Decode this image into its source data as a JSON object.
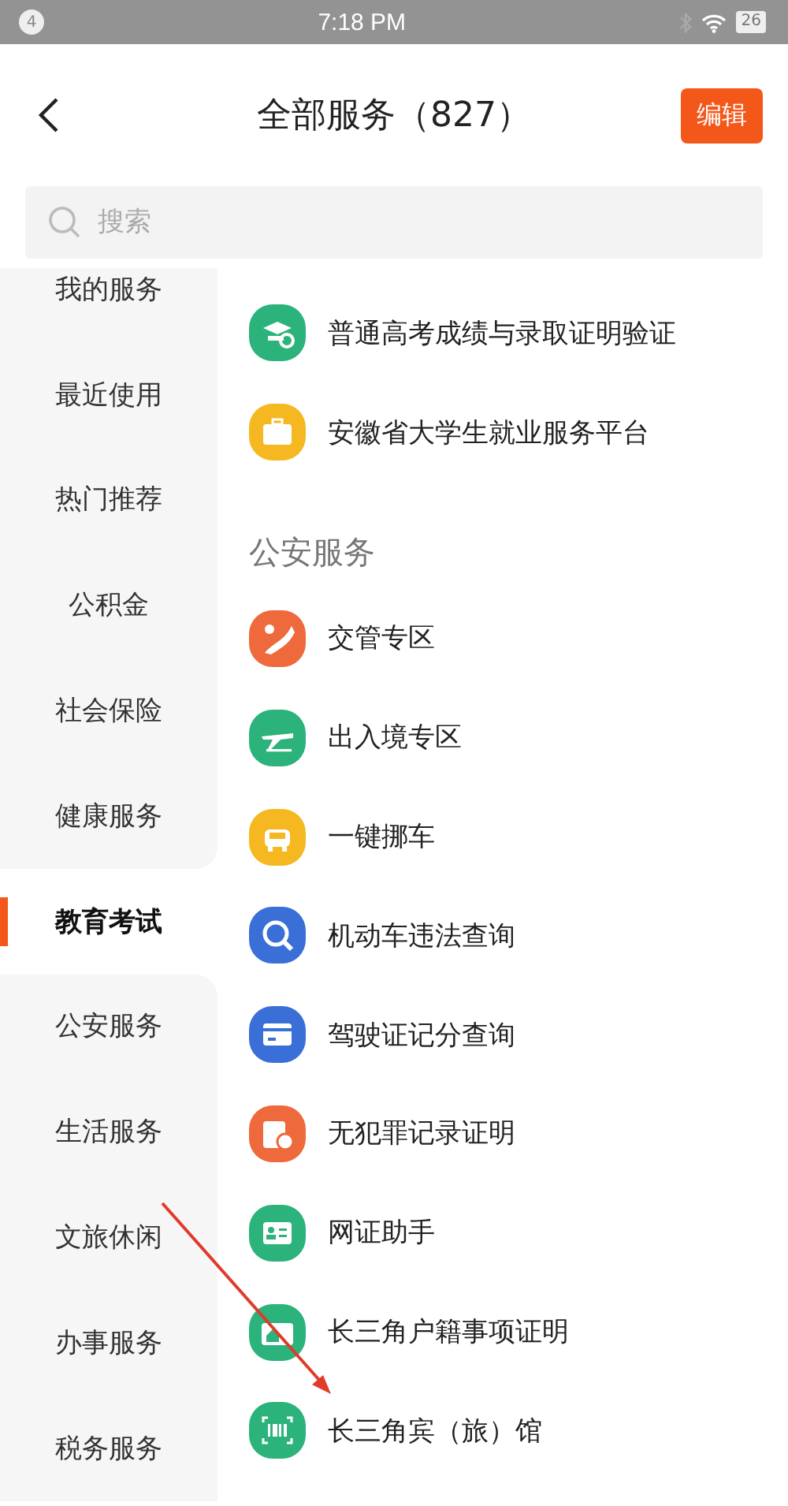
{
  "status_bar": {
    "notification_count": "4",
    "time": "7:18 PM",
    "battery": "26"
  },
  "header": {
    "title": "全部服务（827）",
    "edit_button": "编辑"
  },
  "search": {
    "placeholder": "搜索"
  },
  "sidebar": {
    "items": [
      {
        "label": "我的服务",
        "selected": false
      },
      {
        "label": "最近使用",
        "selected": false
      },
      {
        "label": "热门推荐",
        "selected": false
      },
      {
        "label": "公积金",
        "selected": false
      },
      {
        "label": "社会保险",
        "selected": false
      },
      {
        "label": "健康服务",
        "selected": false
      },
      {
        "label": "教育考试",
        "selected": true
      },
      {
        "label": "公安服务",
        "selected": false
      },
      {
        "label": "生活服务",
        "selected": false
      },
      {
        "label": "文旅休闲",
        "selected": false
      },
      {
        "label": "办事服务",
        "selected": false
      },
      {
        "label": "税务服务",
        "selected": false
      }
    ]
  },
  "sections": [
    {
      "services": [
        {
          "label": "普通高考成绩与录取证明验证",
          "color": "#2bb37b"
        },
        {
          "label": "安徽省大学生就业服务平台",
          "color": "#f5b820"
        }
      ]
    },
    {
      "title": "公安服务",
      "services": [
        {
          "label": "交管专区",
          "color": "#ee6a3c"
        },
        {
          "label": "出入境专区",
          "color": "#2bb37b"
        },
        {
          "label": "一键挪车",
          "color": "#f5b820"
        },
        {
          "label": "机动车违法查询",
          "color": "#3a6fd8"
        },
        {
          "label": "驾驶证记分查询",
          "color": "#3a6fd8"
        },
        {
          "label": "无犯罪记录证明",
          "color": "#ee6a3c"
        },
        {
          "label": "网证助手",
          "color": "#2bb37b"
        },
        {
          "label": "长三角户籍事项证明",
          "color": "#2bb37b"
        },
        {
          "label": "长三角宾（旅）馆",
          "color": "#2bb37b"
        }
      ]
    }
  ]
}
